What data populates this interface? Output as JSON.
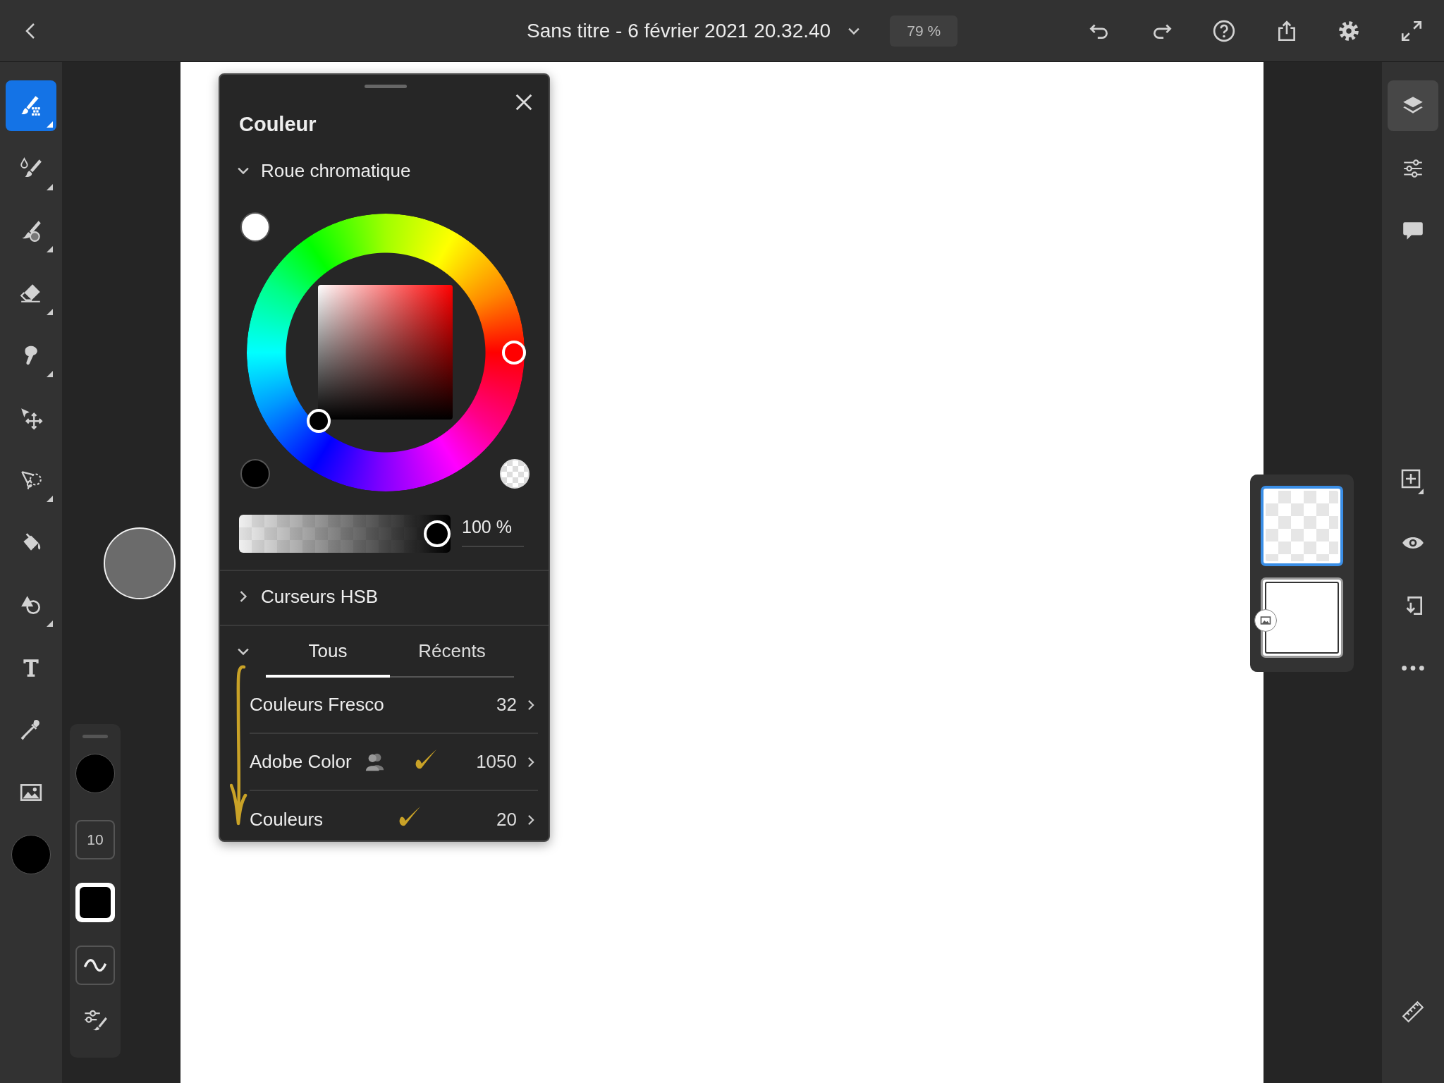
{
  "top_bar": {
    "document_title": "Sans titre - 6 février 2021 20.32.40",
    "zoom": "79 %",
    "actions": [
      {
        "kind": "undo"
      },
      {
        "kind": "redo"
      },
      {
        "kind": "help"
      },
      {
        "kind": "share"
      },
      {
        "kind": "settings"
      },
      {
        "kind": "fullscreen"
      }
    ]
  },
  "tools": [
    {
      "kind": "pixel-brush",
      "selected": true,
      "submenu": true
    },
    {
      "kind": "watercolor-brush",
      "selected": false,
      "submenu": true
    },
    {
      "kind": "live-brush",
      "selected": false,
      "submenu": true
    },
    {
      "kind": "eraser",
      "selected": false,
      "submenu": true
    },
    {
      "kind": "smudge",
      "selected": false,
      "submenu": true
    },
    {
      "kind": "move",
      "selected": false,
      "submenu": false
    },
    {
      "kind": "lasso",
      "selected": false,
      "submenu": true
    },
    {
      "kind": "fill",
      "selected": false,
      "submenu": false
    },
    {
      "kind": "shapes",
      "selected": false,
      "submenu": true
    },
    {
      "kind": "text",
      "selected": false,
      "submenu": false
    },
    {
      "kind": "eyedropper",
      "selected": false,
      "submenu": false
    },
    {
      "kind": "image",
      "selected": false,
      "submenu": false
    }
  ],
  "tool_options": {
    "size": "10"
  },
  "color_panel": {
    "title": "Couleur",
    "wheel_section": {
      "label": "Roue chromatique",
      "expanded": true
    },
    "opacity": {
      "level": 1,
      "reading": "100 %"
    },
    "hsb_section": {
      "label": "Curseurs HSB",
      "expanded": false
    },
    "libraries": {
      "expanded": true,
      "handwritten_arrow": true,
      "tabs": [
        {
          "label": "Tous",
          "selected": true
        },
        {
          "label": "Récents",
          "selected": false
        }
      ],
      "rows": [
        {
          "name": "Couleurs Fresco",
          "count": "32",
          "shared": false,
          "handwritten_check": false
        },
        {
          "name": "Adobe Color",
          "count": "1050",
          "shared": true,
          "handwritten_check": true
        },
        {
          "name": "Couleurs",
          "count": "20",
          "shared": false,
          "handwritten_check": true
        }
      ]
    }
  },
  "layers": [
    {
      "kind": "transparent",
      "selected": true
    },
    {
      "kind": "image",
      "selected": false
    }
  ],
  "right_tools": [
    {
      "kind": "layers",
      "selected": true
    },
    {
      "kind": "adjustments",
      "selected": false
    },
    {
      "kind": "comment",
      "selected": false
    },
    {
      "kind": "add-layer",
      "selected": false
    },
    {
      "kind": "visibility",
      "selected": false
    },
    {
      "kind": "merge-down",
      "selected": false
    },
    {
      "kind": "more",
      "selected": false
    },
    {
      "kind": "ruler",
      "selected": false
    }
  ]
}
